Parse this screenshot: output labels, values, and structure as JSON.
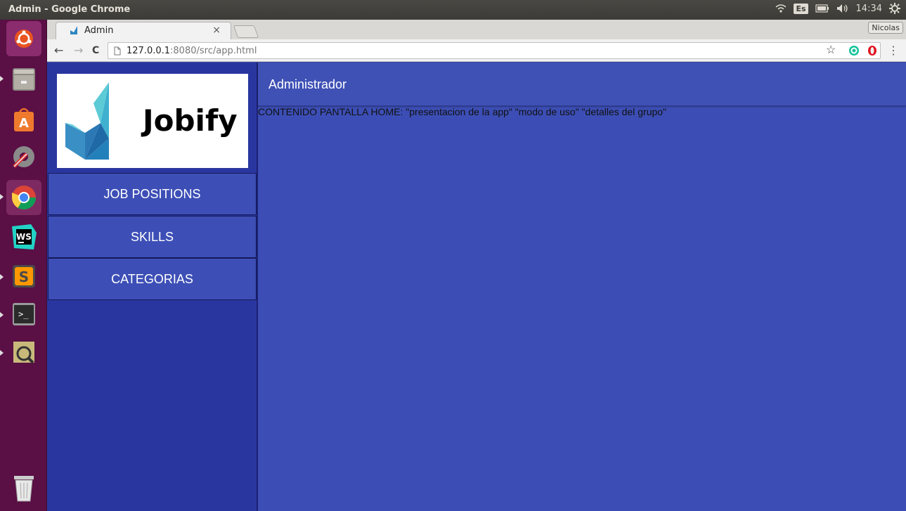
{
  "os": {
    "window_title": "Admin - Google Chrome",
    "keyboard_layout": "Es",
    "clock": "14:34",
    "user_badge": "Nicolas"
  },
  "launcher": {
    "apps": [
      "ubuntu-dash-icon",
      "files-icon",
      "software-center-icon",
      "system-settings-icon",
      "chrome-icon",
      "webstorm-icon",
      "sublime-text-icon",
      "terminal-icon",
      "screenshot-viewer-icon",
      "trash-icon"
    ]
  },
  "browser": {
    "tab_title": "Admin",
    "tab_close": "×",
    "url_host": "127.0.0.1",
    "url_rest": ":8080/src/app.html",
    "nav_back": "←",
    "nav_forward": "→",
    "nav_reload": "C",
    "bookmark_star": "☆",
    "menu": "⋮"
  },
  "app": {
    "logo_text": "Jobify",
    "menu": [
      {
        "label": "JOB POSITIONS"
      },
      {
        "label": "SKILLS"
      },
      {
        "label": "CATEGORIAS"
      }
    ],
    "header_title": "Administrador",
    "home_content": "CONTENIDO PANTALLA HOME: \"presentacion de la app\" \"modo de uso\" \"detalles del grupo\""
  },
  "colors": {
    "page_bg": "#3c4eb5",
    "sidenav_bg": "#2a36a0",
    "launcher_bg": "#5a0f45"
  }
}
